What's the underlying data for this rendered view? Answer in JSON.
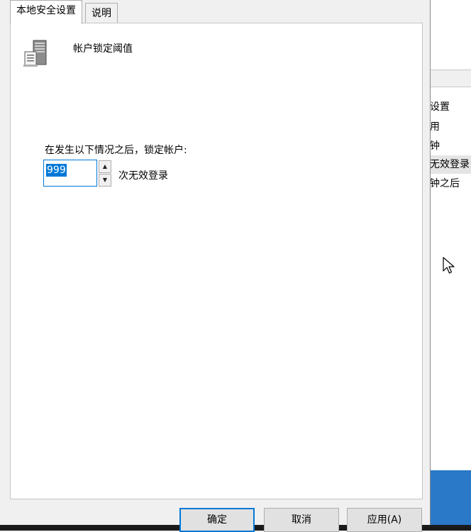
{
  "dialog": {
    "tabs": [
      {
        "label": "本地安全设置",
        "active": true
      },
      {
        "label": "说明",
        "active": false
      }
    ],
    "policy_name": "帐户锁定阈值",
    "lockout_label": "在发生以下情况之后，锁定帐户:",
    "threshold_value": "999",
    "threshold_unit": "次无效登录",
    "buttons": {
      "ok": "确定",
      "cancel": "取消",
      "apply": "应用(A)"
    }
  },
  "background_list": {
    "items": [
      {
        "text": "设置",
        "selected": false
      },
      {
        "text": "用",
        "selected": false
      },
      {
        "text": "钟",
        "selected": false
      },
      {
        "text": "无效登录",
        "selected": true
      },
      {
        "text": "钟之后",
        "selected": false
      }
    ]
  },
  "colors": {
    "accent": "#0078d7",
    "desktop": "#2a78c8"
  },
  "icons": [
    "server-icon",
    "spin-up-icon",
    "spin-down-icon",
    "mouse-cursor-icon"
  ]
}
